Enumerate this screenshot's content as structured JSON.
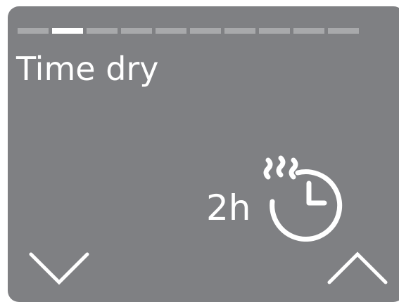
{
  "program": {
    "title": "Time dry",
    "duration": "2h",
    "icon": "time-dry-icon"
  },
  "progress": {
    "total": 10,
    "active_index": 1
  },
  "navigation": {
    "down_icon": "chevron-down-icon",
    "up_icon": "chevron-up-icon"
  },
  "colors": {
    "background": "#7f8083",
    "text": "#ffffff",
    "progress_inactive": "#a8a9ab",
    "progress_active": "#ffffff"
  }
}
